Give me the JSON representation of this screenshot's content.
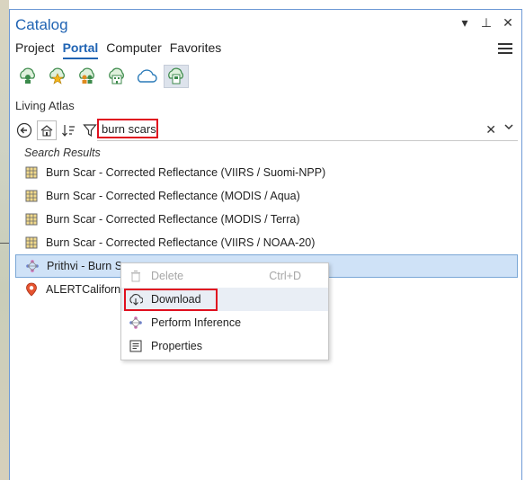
{
  "pane": {
    "title": "Catalog"
  },
  "title_controls": [
    "▾",
    "⊥",
    "✕"
  ],
  "tabs": [
    {
      "label": "Project",
      "active": false
    },
    {
      "label": "Portal",
      "active": true
    },
    {
      "label": "Computer",
      "active": false
    },
    {
      "label": "Favorites",
      "active": false
    }
  ],
  "portal_icons": [
    "my-content-icon",
    "favorites-icon",
    "groups-icon",
    "organization-icon",
    "arcgis-online-icon",
    "living-atlas-icon"
  ],
  "section_label": "Living Atlas",
  "search": {
    "value": "burn scars",
    "placeholder": ""
  },
  "results_label": "Search Results",
  "results": [
    {
      "label": "Burn Scar - Corrected Reflectance (VIIRS / Suomi-NPP)",
      "icon": "imagery-layer-icon"
    },
    {
      "label": "Burn Scar - Corrected Reflectance (MODIS / Aqua)",
      "icon": "imagery-layer-icon"
    },
    {
      "label": "Burn Scar - Corrected Reflectance (MODIS / Terra)",
      "icon": "imagery-layer-icon"
    },
    {
      "label": "Burn Scar - Corrected Reflectance (VIIRS / NOAA-20)",
      "icon": "imagery-layer-icon"
    },
    {
      "label": "Prithvi - Burn Sc",
      "icon": "deep-learning-package-icon",
      "selected": true
    },
    {
      "label": "ALERTCalifornia",
      "icon": "feature-layer-icon"
    }
  ],
  "context_menu": {
    "items": [
      {
        "label": "Delete",
        "shortcut": "Ctrl+D",
        "icon": "trash-icon",
        "disabled": true
      },
      {
        "label": "Download",
        "icon": "download-icon",
        "highlighted": true
      },
      {
        "label": "Perform Inference",
        "icon": "inference-icon"
      },
      {
        "label": "Properties",
        "icon": "properties-icon"
      }
    ]
  },
  "colors": {
    "accent": "#1f63b3",
    "highlight": "#e0101f",
    "selection": "#cfe2f7"
  }
}
